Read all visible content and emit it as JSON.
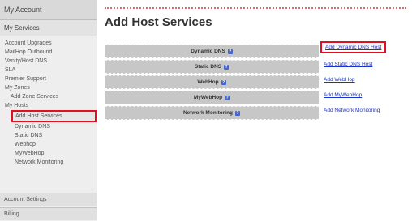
{
  "sidebar": {
    "header": "My Account",
    "section": "My Services",
    "items": [
      {
        "label": "Account Upgrades",
        "level": 0
      },
      {
        "label": "MailHop Outbound",
        "level": 0
      },
      {
        "label": "Vanity/Host DNS",
        "level": 0
      },
      {
        "label": "SLA",
        "level": 0
      },
      {
        "label": "Premier Support",
        "level": 0
      },
      {
        "label": "My Zones",
        "level": 0
      },
      {
        "label": "Add Zone Services",
        "level": 1
      },
      {
        "label": "My Hosts",
        "level": 0
      },
      {
        "label": "Add Host Services",
        "level": 1,
        "highlight": true
      },
      {
        "label": "Dynamic DNS",
        "level": 2
      },
      {
        "label": "Static DNS",
        "level": 2
      },
      {
        "label": "Webhop",
        "level": 2
      },
      {
        "label": "MyWebHop",
        "level": 2
      },
      {
        "label": "Network Monitoring",
        "level": 2
      }
    ],
    "account_settings": "Account Settings",
    "billing": "Billing"
  },
  "main": {
    "title": "Add Host Services",
    "services": [
      {
        "label": "Dynamic DNS",
        "link": "Add Dynamic DNS Host",
        "highlight": true
      },
      {
        "label": "Static DNS",
        "link": "Add Static DNS Host"
      },
      {
        "label": "WebHop",
        "link": "Add WebHop"
      },
      {
        "label": "MyWebHop",
        "link": "Add MyWebHop"
      },
      {
        "label": "Network Monitoring",
        "link": "Add Network Monitoring"
      }
    ],
    "help_glyph": "?"
  },
  "colors": {
    "highlight": "#e01020",
    "link": "#1a33cc",
    "row_bg": "#c7c7c7"
  }
}
